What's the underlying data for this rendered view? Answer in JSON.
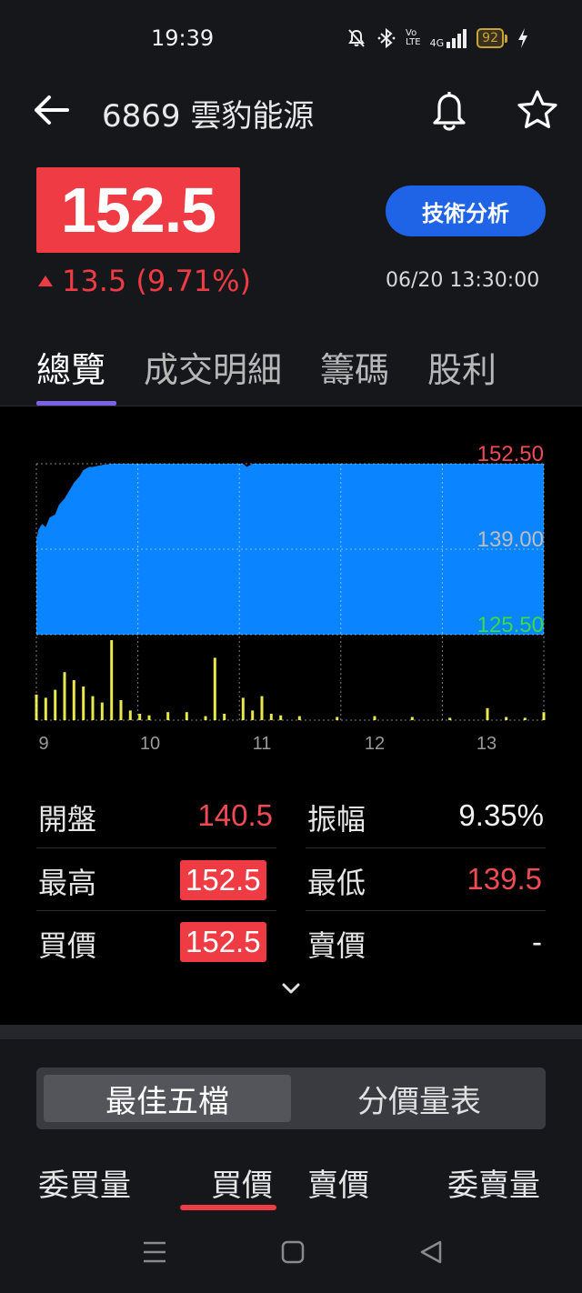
{
  "status_bar": {
    "time": "19:39",
    "network": "4G",
    "volte_top": "Vo",
    "volte_bottom": "LTE",
    "battery": "92",
    "icons": [
      "mute-icon",
      "bluetooth-icon",
      "volte-icon",
      "signal-icon",
      "battery-icon",
      "charging-icon"
    ]
  },
  "header": {
    "title": "6869 雲豹能源",
    "icons": [
      "back-arrow-icon",
      "bell-icon",
      "star-icon"
    ]
  },
  "quote": {
    "price": "152.5",
    "change": "13.5 (9.71%)",
    "timestamp": "06/20 13:30:00",
    "tech_button": "技術分析",
    "accent_up": "#ef3b43",
    "accent_button": "#1f64e6"
  },
  "tabs": [
    {
      "label": "總覽",
      "active": true
    },
    {
      "label": "成交明細",
      "active": false
    },
    {
      "label": "籌碼",
      "active": false
    },
    {
      "label": "股利",
      "active": false
    }
  ],
  "chart_data": {
    "type": "area",
    "x_ticks": [
      "9",
      "10",
      "11",
      "12",
      "13"
    ],
    "y_ticks": [
      "152.50",
      "139.00",
      "125.50"
    ],
    "y_tick_colors": [
      "#ef4b55",
      "#bdbdbd",
      "#3ddc3d"
    ],
    "ylim": [
      125.5,
      152.5
    ],
    "xlim": [
      "09:00",
      "13:30"
    ],
    "area_color": "#0a84ff",
    "volume_color": "#e8e84a",
    "price_series": {
      "x": [
        "09:00",
        "09:01",
        "09:03",
        "09:05",
        "09:07",
        "09:10",
        "09:12",
        "09:15",
        "09:18",
        "09:20",
        "09:23",
        "09:25",
        "09:28",
        "09:30",
        "09:35",
        "09:40",
        "09:45",
        "09:50",
        "10:00",
        "10:30",
        "10:50",
        "10:52",
        "10:55",
        "11:00",
        "11:30",
        "12:00",
        "12:30",
        "13:00",
        "13:30"
      ],
      "y": [
        140.5,
        142.0,
        143.0,
        142.5,
        144.0,
        144.5,
        146.0,
        147.0,
        148.5,
        149.5,
        150.5,
        151.5,
        152.0,
        152.0,
        152.3,
        152.5,
        152.5,
        152.5,
        152.5,
        152.5,
        152.5,
        152.0,
        152.5,
        152.5,
        152.5,
        152.5,
        152.5,
        152.5,
        152.5
      ]
    },
    "volume_series": {
      "x": [
        "09:00",
        "09:05",
        "09:10",
        "09:15",
        "09:20",
        "09:25",
        "09:30",
        "09:35",
        "09:40",
        "09:45",
        "09:50",
        "09:55",
        "10:00",
        "10:10",
        "10:20",
        "10:30",
        "10:35",
        "10:40",
        "10:50",
        "10:55",
        "11:00",
        "11:05",
        "11:10",
        "11:20",
        "11:40",
        "12:00",
        "12:20",
        "12:40",
        "13:00",
        "13:10",
        "13:20",
        "13:30"
      ],
      "v": [
        32,
        28,
        38,
        60,
        50,
        42,
        30,
        22,
        100,
        25,
        12,
        8,
        6,
        10,
        10,
        5,
        78,
        8,
        28,
        12,
        30,
        8,
        6,
        5,
        4,
        5,
        4,
        3,
        15,
        4,
        3,
        10
      ]
    }
  },
  "stats": {
    "open_label": "開盤",
    "open_value": "140.5",
    "amplitude_label": "振幅",
    "amplitude_value": "9.35%",
    "high_label": "最高",
    "high_value": "152.5",
    "low_label": "最低",
    "low_value": "139.5",
    "bid_label": "買價",
    "bid_value": "152.5",
    "ask_label": "賣價",
    "ask_value": "-"
  },
  "order_book": {
    "segments": [
      {
        "label": "最佳五檔",
        "active": true
      },
      {
        "label": "分價量表",
        "active": false
      }
    ],
    "columns": [
      "委買量",
      "買價",
      "賣價",
      "委賣量"
    ]
  }
}
